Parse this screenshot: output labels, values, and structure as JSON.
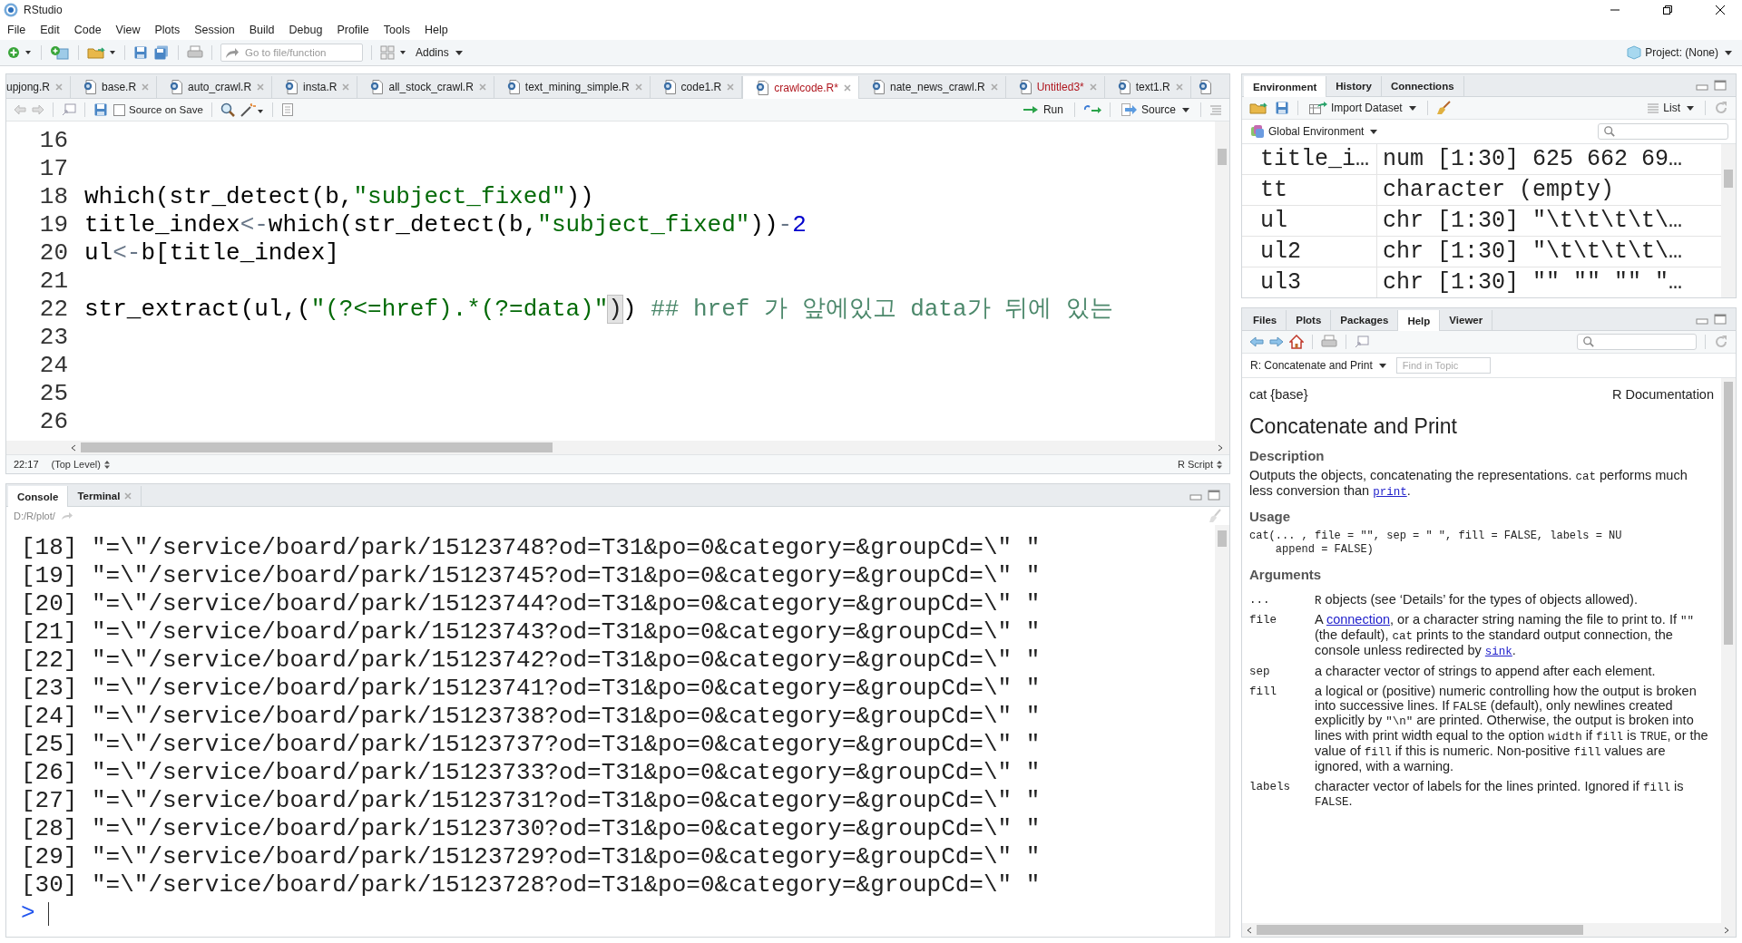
{
  "window": {
    "title": "RStudio"
  },
  "menu": [
    "File",
    "Edit",
    "Code",
    "View",
    "Plots",
    "Session",
    "Build",
    "Debug",
    "Profile",
    "Tools",
    "Help"
  ],
  "main_toolbar": {
    "goto_placeholder": "Go to file/function",
    "addins": "Addins",
    "project": "Project: (None)"
  },
  "editor": {
    "tabs": [
      {
        "label": "upjong.R",
        "selected": false,
        "modified": false,
        "icon": false
      },
      {
        "label": "base.R",
        "selected": false,
        "modified": false,
        "icon": true
      },
      {
        "label": "auto_crawl.R",
        "selected": false,
        "modified": false,
        "icon": true
      },
      {
        "label": "insta.R",
        "selected": false,
        "modified": false,
        "icon": true
      },
      {
        "label": "all_stock_crawl.R",
        "selected": false,
        "modified": false,
        "icon": true
      },
      {
        "label": "text_mining_simple.R",
        "selected": false,
        "modified": false,
        "icon": true
      },
      {
        "label": "code1.R",
        "selected": false,
        "modified": false,
        "icon": true
      },
      {
        "label": "crawlcode.R*",
        "selected": true,
        "modified": true,
        "icon": true
      },
      {
        "label": "nate_news_crawl.R",
        "selected": false,
        "modified": false,
        "icon": true
      },
      {
        "label": "Untitled3*",
        "selected": false,
        "modified": true,
        "icon": true
      },
      {
        "label": "text1.R",
        "selected": false,
        "modified": false,
        "icon": true
      }
    ],
    "source_on_save": {
      "label": "Source on Save",
      "checked": false
    },
    "run": "Run",
    "source": "Source",
    "lines": [
      {
        "number": "16"
      },
      {
        "number": "17"
      },
      {
        "number": "18",
        "tokens": [
          {
            "kind": "plain",
            "text": "which(str_detect(b,"
          },
          {
            "kind": "string",
            "text": "\"subject_fixed\""
          },
          {
            "kind": "plain",
            "text": "))"
          }
        ]
      },
      {
        "number": "19",
        "tokens": [
          {
            "kind": "plain",
            "text": "title_index"
          },
          {
            "kind": "op",
            "text": "<-"
          },
          {
            "kind": "plain",
            "text": "which(str_detect(b,"
          },
          {
            "kind": "string",
            "text": "\"subject_fixed\""
          },
          {
            "kind": "plain",
            "text": "))"
          },
          {
            "kind": "op",
            "text": "-"
          },
          {
            "kind": "number",
            "text": "2"
          }
        ]
      },
      {
        "number": "20",
        "tokens": [
          {
            "kind": "plain",
            "text": "ul"
          },
          {
            "kind": "op",
            "text": "<-"
          },
          {
            "kind": "plain",
            "text": "b[title_index]"
          }
        ]
      },
      {
        "number": "21"
      },
      {
        "number": "22",
        "tokens": [
          {
            "kind": "plain",
            "text": "str_extract(ul,("
          },
          {
            "kind": "string",
            "text": "\"(?<=href).*(?=data)\""
          },
          {
            "kind": "match",
            "text": ")"
          },
          {
            "kind": "plain",
            "text": ") "
          },
          {
            "kind": "comment",
            "text": "## href 가 앞에있고 data가 뒤에 있는"
          }
        ]
      },
      {
        "number": "23"
      },
      {
        "number": "24"
      },
      {
        "number": "25"
      },
      {
        "number": "26"
      }
    ],
    "status": {
      "position": "22:17",
      "scope": "(Top Level)",
      "type": "R Script"
    }
  },
  "console": {
    "tabs": [
      {
        "label": "Console",
        "selected": true,
        "closable": false
      },
      {
        "label": "Terminal",
        "selected": false,
        "closable": true
      }
    ],
    "path": "D:/R/plot/",
    "lines": [
      "[18] \"=\\\"/service/board/park/15123748?od=T31&po=0&category=&groupCd=\\\" \"",
      "[19] \"=\\\"/service/board/park/15123745?od=T31&po=0&category=&groupCd=\\\" \"",
      "[20] \"=\\\"/service/board/park/15123744?od=T31&po=0&category=&groupCd=\\\" \"",
      "[21] \"=\\\"/service/board/park/15123743?od=T31&po=0&category=&groupCd=\\\" \"",
      "[22] \"=\\\"/service/board/park/15123742?od=T31&po=0&category=&groupCd=\\\" \"",
      "[23] \"=\\\"/service/board/park/15123741?od=T31&po=0&category=&groupCd=\\\" \"",
      "[24] \"=\\\"/service/board/park/15123738?od=T31&po=0&category=&groupCd=\\\" \"",
      "[25] \"=\\\"/service/board/park/15123737?od=T31&po=0&category=&groupCd=\\\" \"",
      "[26] \"=\\\"/service/board/park/15123733?od=T31&po=0&category=&groupCd=\\\" \"",
      "[27] \"=\\\"/service/board/park/15123731?od=T31&po=0&category=&groupCd=\\\" \"",
      "[28] \"=\\\"/service/board/park/15123730?od=T31&po=0&category=&groupCd=\\\" \"",
      "[29] \"=\\\"/service/board/park/15123729?od=T31&po=0&category=&groupCd=\\\" \"",
      "[30] \"=\\\"/service/board/park/15123728?od=T31&po=0&category=&groupCd=\\\" \""
    ],
    "prompt": ">"
  },
  "environment": {
    "tabs": [
      {
        "label": "Environment",
        "selected": true
      },
      {
        "label": "History",
        "selected": false
      },
      {
        "label": "Connections",
        "selected": false
      }
    ],
    "import": "Import Dataset",
    "view": "List",
    "scope": "Global Environment",
    "rows": [
      {
        "name": "title_i…",
        "value": "num [1:30] 625 662 69…"
      },
      {
        "name": "tt",
        "value": "character (empty)"
      },
      {
        "name": "ul",
        "value": "chr [1:30] \"\\t\\t\\t\\t\\…"
      },
      {
        "name": "ul2",
        "value": "chr [1:30] \"\\t\\t\\t\\t\\…"
      },
      {
        "name": "ul3",
        "value": "chr [1:30] \"\" \"\" \"\" \"…"
      }
    ]
  },
  "help": {
    "tabs": [
      {
        "label": "Files",
        "selected": false
      },
      {
        "label": "Plots",
        "selected": false
      },
      {
        "label": "Packages",
        "selected": false
      },
      {
        "label": "Help",
        "selected": true
      },
      {
        "label": "Viewer",
        "selected": false
      }
    ],
    "topic": "R: Concatenate and Print",
    "find_placeholder": "Find in Topic",
    "package": "cat {base}",
    "doc_label": "R Documentation",
    "title": "Concatenate and Print",
    "description_heading": "Description",
    "description": [
      {
        "kind": "text",
        "text": "Outputs the objects, concatenating the representations. "
      },
      {
        "kind": "code",
        "text": "cat"
      },
      {
        "kind": "text",
        "text": " performs much less conversion than "
      },
      {
        "kind": "codelink",
        "text": "print"
      },
      {
        "kind": "text",
        "text": "."
      }
    ],
    "usage_heading": "Usage",
    "usage": [
      "cat(... , file = \"\", sep = \" \", fill = FALSE, labels = NU",
      "    append = FALSE)"
    ],
    "arguments_heading": "Arguments",
    "arguments": [
      {
        "name": "...",
        "segments": [
          {
            "kind": "code",
            "text": "R"
          },
          {
            "kind": "text",
            "text": " objects (see ‘Details’ for the types of objects allowed)."
          }
        ]
      },
      {
        "name": "file",
        "segments": [
          {
            "kind": "text",
            "text": "A "
          },
          {
            "kind": "link",
            "text": "connection"
          },
          {
            "kind": "text",
            "text": ", or a character string naming the file to print to. If "
          },
          {
            "kind": "code",
            "text": "\"\""
          },
          {
            "kind": "text",
            "text": " (the default), "
          },
          {
            "kind": "code",
            "text": "cat"
          },
          {
            "kind": "text",
            "text": " prints to the standard output connection, the console unless redirected by "
          },
          {
            "kind": "codelink",
            "text": "sink"
          },
          {
            "kind": "text",
            "text": "."
          }
        ]
      },
      {
        "name": "sep",
        "segments": [
          {
            "kind": "text",
            "text": "a character vector of strings to append after each element."
          }
        ]
      },
      {
        "name": "fill",
        "segments": [
          {
            "kind": "text",
            "text": "a logical or (positive) numeric controlling how the output is broken into successive lines. If "
          },
          {
            "kind": "code",
            "text": "FALSE"
          },
          {
            "kind": "text",
            "text": " (default), only newlines created explicitly by "
          },
          {
            "kind": "code",
            "text": "\"\\n\""
          },
          {
            "kind": "text",
            "text": " are printed. Otherwise, the output is broken into lines with print width equal to the option "
          },
          {
            "kind": "code",
            "text": "width"
          },
          {
            "kind": "text",
            "text": " if "
          },
          {
            "kind": "code",
            "text": "fill"
          },
          {
            "kind": "text",
            "text": " is "
          },
          {
            "kind": "code",
            "text": "TRUE"
          },
          {
            "kind": "text",
            "text": ", or the value of "
          },
          {
            "kind": "code",
            "text": "fill"
          },
          {
            "kind": "text",
            "text": " if this is numeric. Non-positive "
          },
          {
            "kind": "code",
            "text": "fill"
          },
          {
            "kind": "text",
            "text": " values are ignored, with a warning."
          }
        ]
      },
      {
        "name": "labels",
        "segments": [
          {
            "kind": "text",
            "text": "character vector of labels for the lines printed. Ignored if "
          },
          {
            "kind": "code",
            "text": "fill"
          },
          {
            "kind": "text",
            "text": " is "
          },
          {
            "kind": "code",
            "text": "FALSE"
          },
          {
            "kind": "text",
            "text": "."
          }
        ]
      }
    ]
  }
}
